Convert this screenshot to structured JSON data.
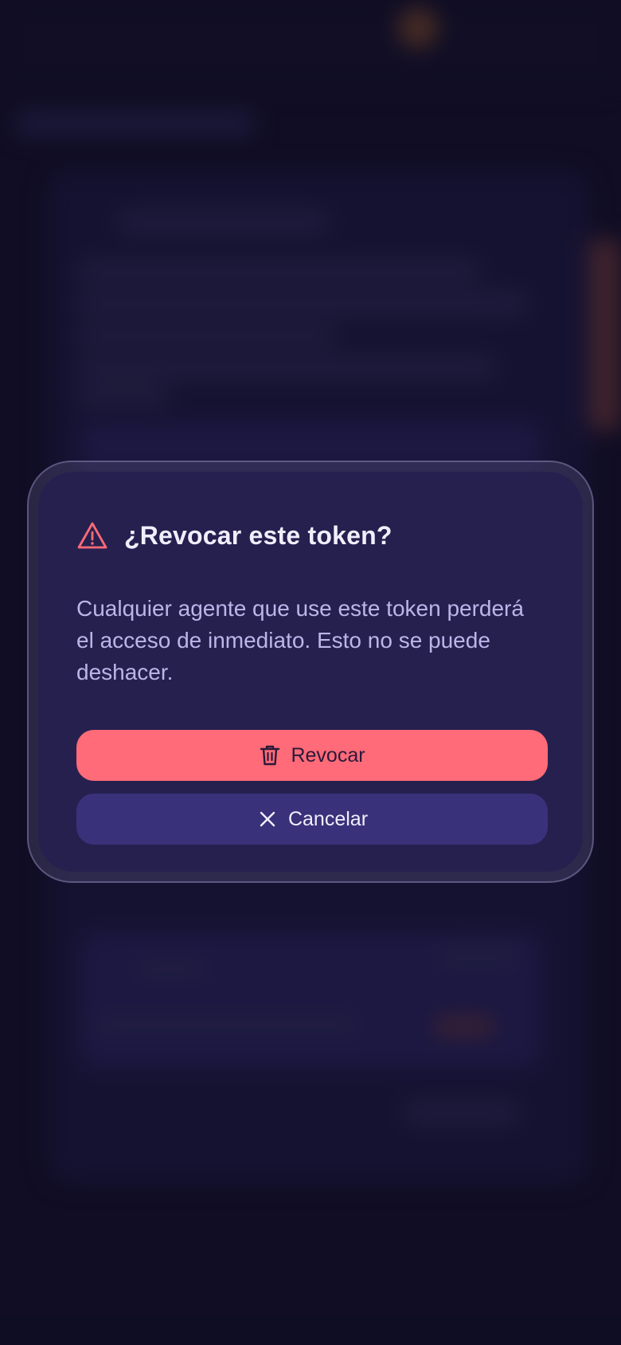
{
  "dialog": {
    "title": "¿Revocar este token?",
    "message": "Cualquier agente que use este token perderá el acceso de inmediato. Esto no se puede deshacer.",
    "confirm_label": "Revocar",
    "cancel_label": "Cancelar",
    "icons": {
      "header": "warning-icon",
      "confirm": "trash-icon",
      "cancel": "close-icon"
    }
  },
  "colors": {
    "background": "#14112a",
    "dialog": "#26204f",
    "danger": "#ff6b78",
    "cancel": "#39327a",
    "title": "#f1eefc",
    "body_text": "#bdb5e8"
  }
}
